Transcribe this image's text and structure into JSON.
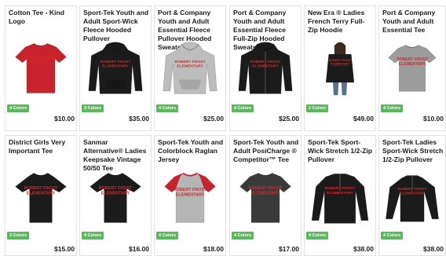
{
  "products": [
    {
      "name": "Cotton Tee - Kind Logo",
      "colors": "4 Colors",
      "price": "$10.00",
      "style": "tee",
      "color": "#c8232c"
    },
    {
      "name": "Sport-Tek Youth and Adult Sport-Wick Fleece Hooded Pullover",
      "colors": "3 Colors",
      "price": "$35.00",
      "style": "hoodie",
      "color": "#1b1b1b"
    },
    {
      "name": "Port & Company Youth and Adult Essential Fleece Pullover Hooded Sweatshirt",
      "colors": "4 Colors",
      "price": "$25.00",
      "style": "hoodie",
      "color": "#bdbdbd"
    },
    {
      "name": "Port & Company Youth and Adult Essential Fleece Full-Zip Hooded Sweatshirt",
      "colors": "4 Colors",
      "price": "$25.00",
      "style": "zip-hoodie",
      "color": "#1b1b1b"
    },
    {
      "name": "New Era ® Ladies French Terry Full-Zip Hoodie",
      "colors": "2 Colors",
      "price": "$49.00",
      "style": "model",
      "color": "#1b1b1b"
    },
    {
      "name": "Port & Company Youth and Adult Essential Tee",
      "colors": "4 Colors",
      "price": "$10.00",
      "style": "tee",
      "color": "#9c9c9c"
    },
    {
      "name": "District Girls Very Important Tee",
      "colors": "3 Colors",
      "price": "$15.00",
      "style": "tee-girls",
      "color": "#1b1b1b"
    },
    {
      "name": "Sanmar Alternative® Ladies Keepsake Vintage 50/50 Tee",
      "colors": "4 Colors",
      "price": "$16.00",
      "style": "tee-girls",
      "color": "#1b1b1b"
    },
    {
      "name": "Sport-Tek Youth and Colorblock Raglan Jersey",
      "colors": "4 Colors",
      "price": "$18.00",
      "style": "raglan",
      "color": "#b5b5b5"
    },
    {
      "name": "Sport-Tek Youth and Adult PosiCharge ® Competitor™ Tee",
      "colors": "4 Colors",
      "price": "$17.00",
      "style": "tee",
      "color": "#3a3a3a"
    },
    {
      "name": "Sport-Tek Sport-Wick Stretch 1/2-Zip Pullover",
      "colors": "4 Colors",
      "price": "$38.00",
      "style": "quarter-zip",
      "color": "#1b1b1b"
    },
    {
      "name": "Sport-Tek Ladies Sport-Wick Stretch 1/2-Zip Pullover",
      "colors": "4 Colors",
      "price": "$38.00",
      "style": "quarter-zip-ladies",
      "color": "#1b1b1b"
    }
  ],
  "print_text": [
    "ROBERT FROST",
    "ELEMENTARY"
  ],
  "accent": "#5cb85c",
  "print_color": "#d8252c"
}
